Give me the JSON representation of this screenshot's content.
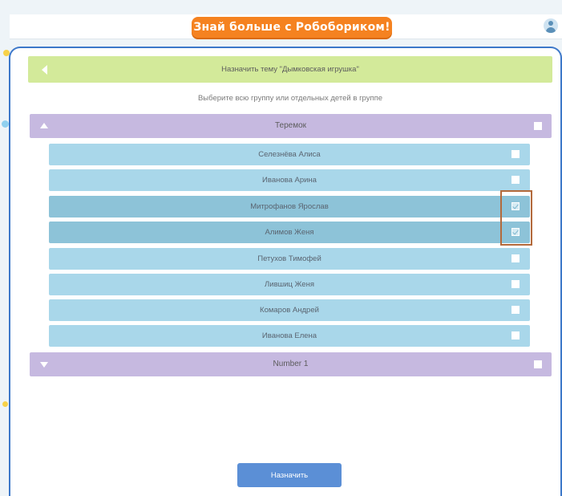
{
  "app": {
    "banner_title": "Знай больше с Робобориком!"
  },
  "assign_topic": {
    "header": "Назначить тему \"Дымковская игрушка\"",
    "subtitle": "Выберите всю группу или отдельных детей в группе"
  },
  "groups": [
    {
      "name": "Теремок",
      "expanded": true,
      "checked": false,
      "children": [
        {
          "name": "Селезнёва Алиса",
          "checked": false
        },
        {
          "name": "Иванова Арина",
          "checked": false
        },
        {
          "name": "Митрофанов Ярослав",
          "checked": true
        },
        {
          "name": "Алимов Женя",
          "checked": true
        },
        {
          "name": "Петухов Тимофей",
          "checked": false
        },
        {
          "name": "Лившиц Женя",
          "checked": false
        },
        {
          "name": "Комаров Андрей",
          "checked": false
        },
        {
          "name": "Иванова Елена",
          "checked": false
        }
      ]
    },
    {
      "name": "Number 1",
      "expanded": false,
      "checked": false
    }
  ],
  "actions": {
    "assign_label": "Назначить"
  },
  "colors": {
    "banner": "#f58220",
    "header_bar": "#d3ea9a",
    "group_bar": "#c6b9e0",
    "child_row": "#a9d7ea",
    "child_row_selected": "#8dc3d8",
    "assign_button": "#5b8fd6",
    "highlight": "#b36a3c"
  },
  "icons": {
    "back": "back-arrow-icon",
    "collapse": "triangle-up-icon",
    "expand": "triangle-down-icon",
    "user": "user-avatar-icon"
  }
}
